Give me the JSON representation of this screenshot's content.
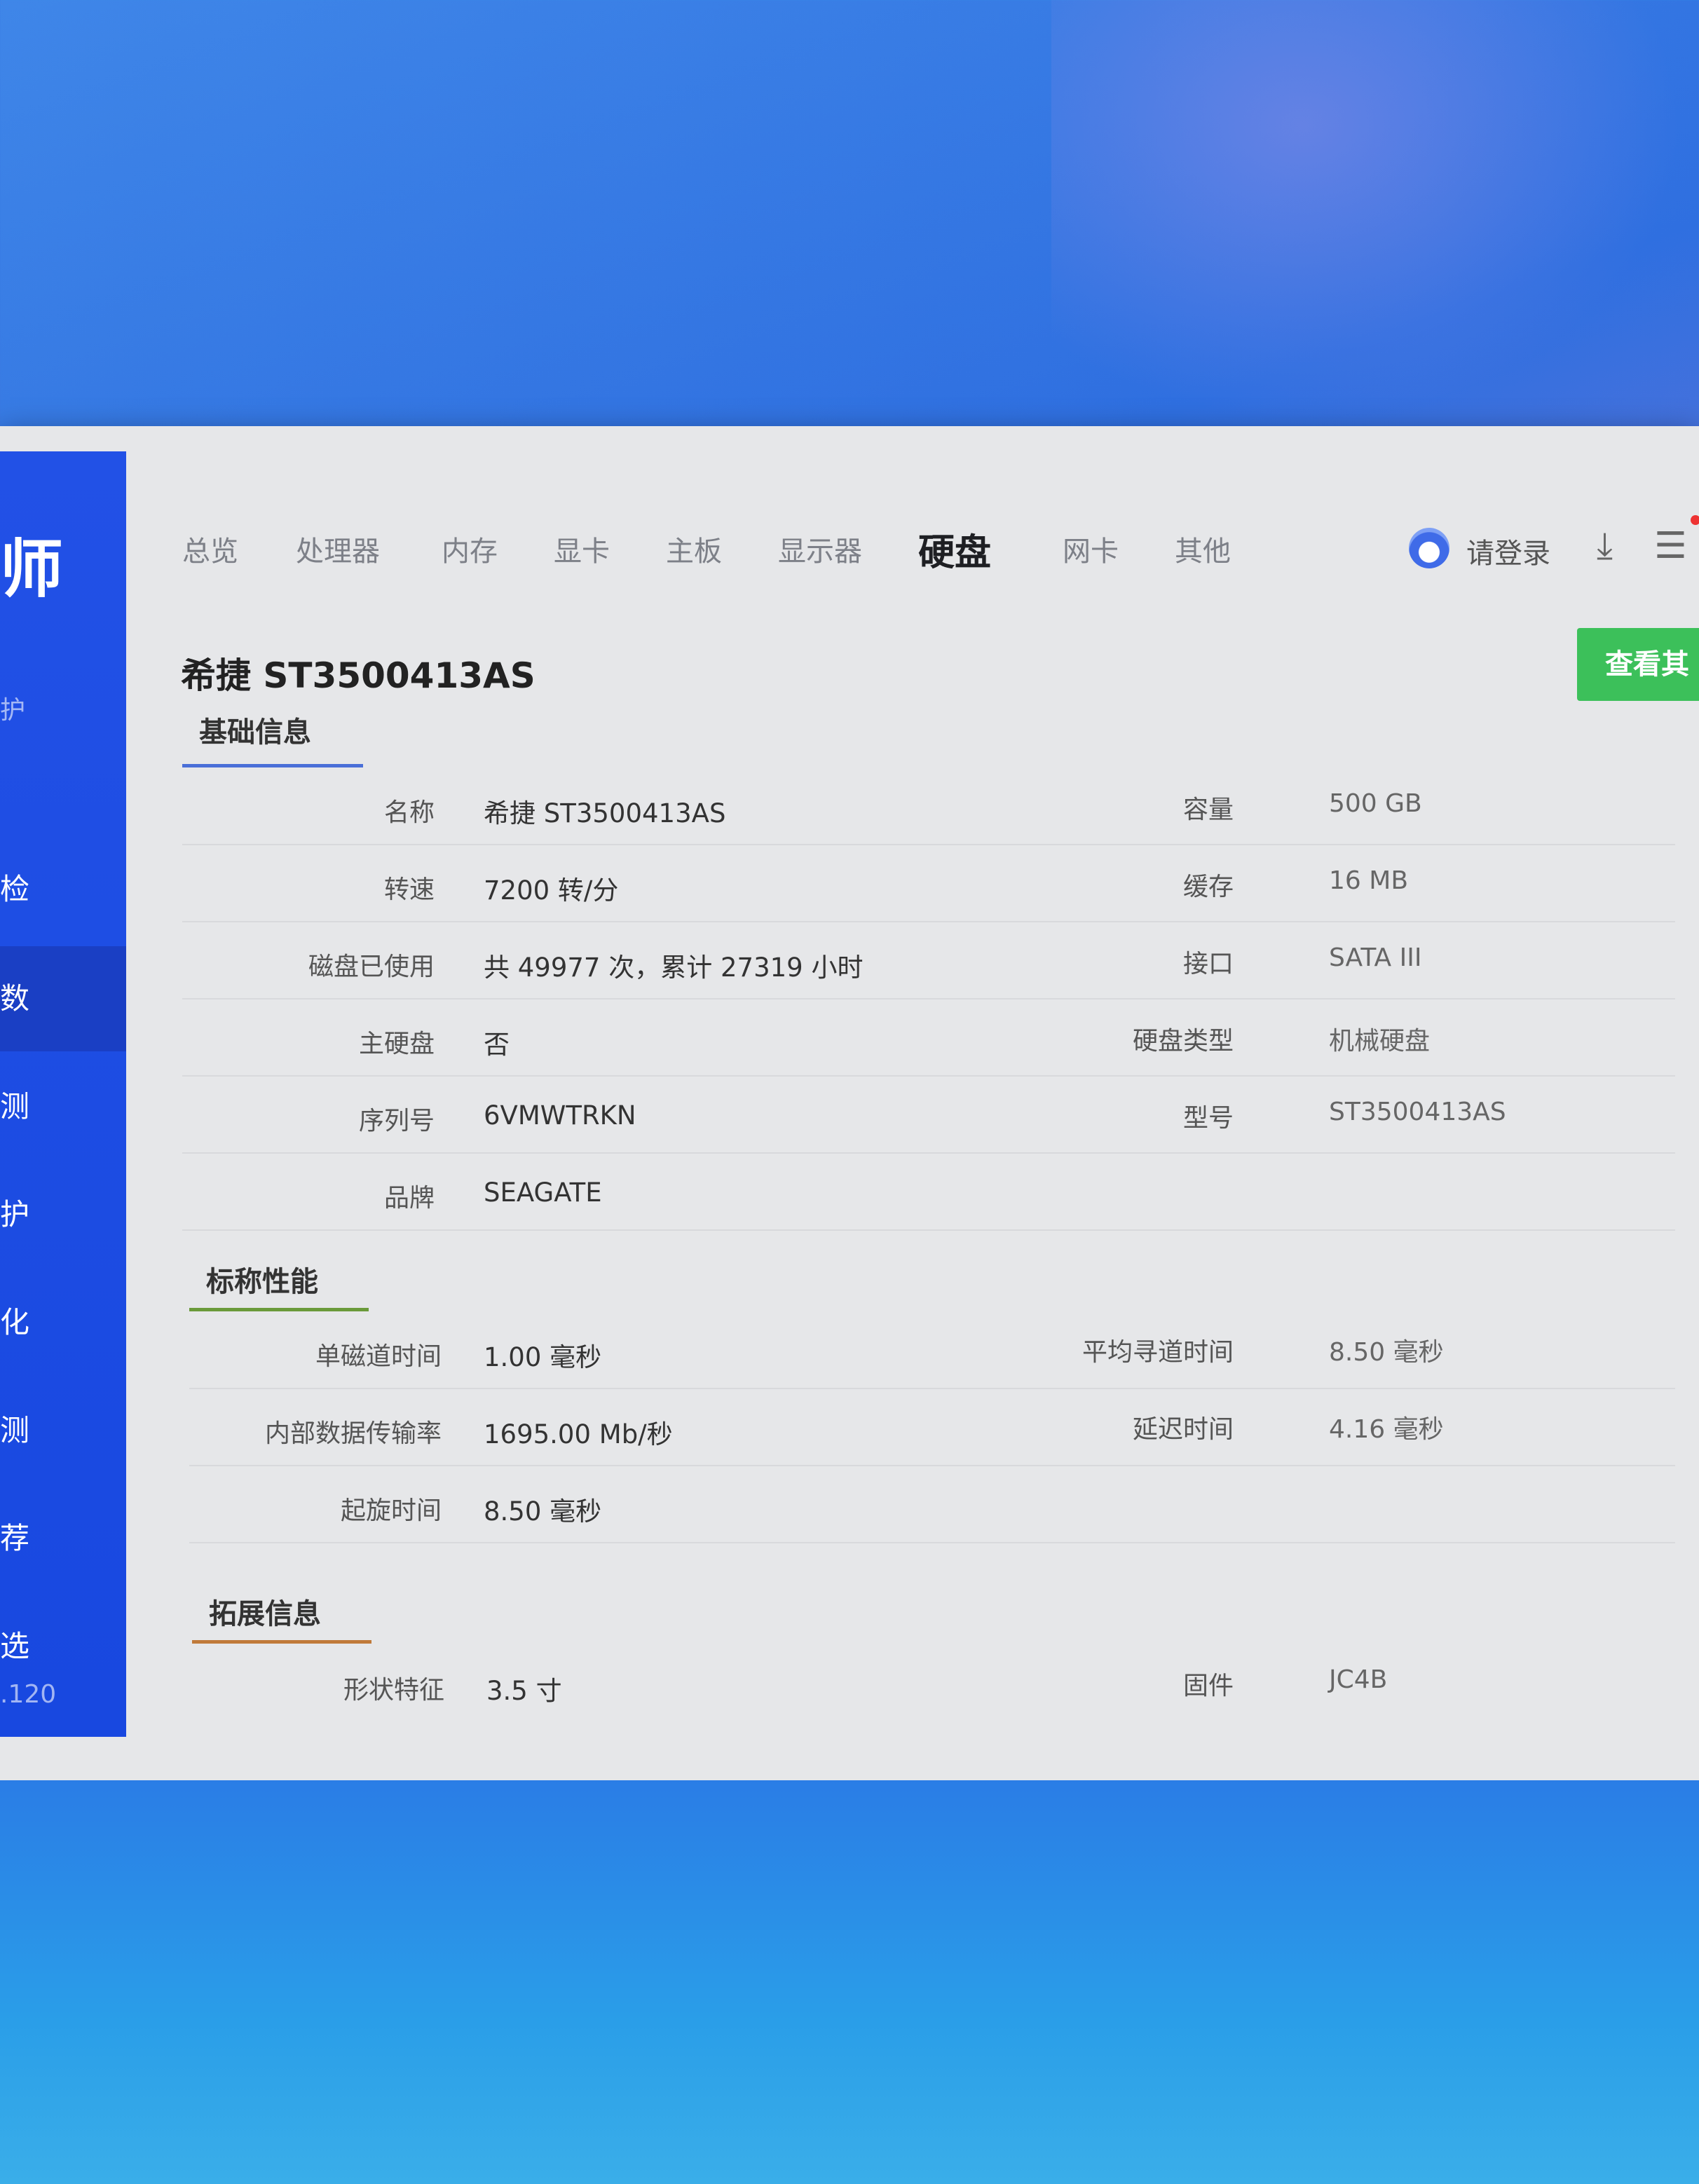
{
  "sidebar": {
    "logo_char": "师",
    "logo_sub": "护",
    "items": [
      {
        "label": "检"
      },
      {
        "label": "数"
      },
      {
        "label": "测"
      },
      {
        "label": "护"
      },
      {
        "label": "化"
      },
      {
        "label": "测"
      },
      {
        "label": "荐"
      },
      {
        "label": "选"
      }
    ],
    "version": ".120"
  },
  "tabs": [
    {
      "label": "总览"
    },
    {
      "label": "处理器"
    },
    {
      "label": "内存"
    },
    {
      "label": "显卡"
    },
    {
      "label": "主板"
    },
    {
      "label": "显示器"
    },
    {
      "label": "硬盘"
    },
    {
      "label": "网卡"
    },
    {
      "label": "其他"
    }
  ],
  "topbar": {
    "login_label": "请登录",
    "download_glyph": "⤓",
    "menu_glyph": "☰"
  },
  "page": {
    "title": "希捷 ST3500413AS",
    "view_other_label": "查看其"
  },
  "sections": {
    "basic": {
      "title": "基础信息",
      "left": [
        {
          "label": "名称",
          "value": "希捷 ST3500413AS"
        },
        {
          "label": "转速",
          "value": "7200 转/分"
        },
        {
          "label": "磁盘已使用",
          "value": "共 49977 次，累计 27319 小时"
        },
        {
          "label": "主硬盘",
          "value": "否"
        },
        {
          "label": "序列号",
          "value": "6VMWTRKN"
        },
        {
          "label": "品牌",
          "value": "SEAGATE"
        }
      ],
      "right": [
        {
          "label": "容量",
          "value": "500 GB"
        },
        {
          "label": "缓存",
          "value": "16 MB"
        },
        {
          "label": "接口",
          "value": "SATA III"
        },
        {
          "label": "硬盘类型",
          "value": "机械硬盘"
        },
        {
          "label": "型号",
          "value": "ST3500413AS"
        }
      ]
    },
    "perf": {
      "title": "标称性能",
      "left": [
        {
          "label": "单磁道时间",
          "value": "1.00 毫秒"
        },
        {
          "label": "内部数据传输率",
          "value": "1695.00 Mb/秒"
        },
        {
          "label": "起旋时间",
          "value": "8.50 毫秒"
        }
      ],
      "right": [
        {
          "label": "平均寻道时间",
          "value": "8.50 毫秒"
        },
        {
          "label": "延迟时间",
          "value": "4.16 毫秒"
        }
      ]
    },
    "ext": {
      "title": "拓展信息",
      "left": [
        {
          "label": "形状特征",
          "value": "3.5 寸"
        }
      ],
      "right": [
        {
          "label": "固件",
          "value": "JC4B"
        }
      ]
    }
  },
  "colors": {
    "sidebar_blue": "#1848e0",
    "accent_green": "#3cc05a",
    "underline_blue": "#4a6fd8",
    "underline_green": "#6a9a3a",
    "underline_orange": "#c07a3a"
  }
}
